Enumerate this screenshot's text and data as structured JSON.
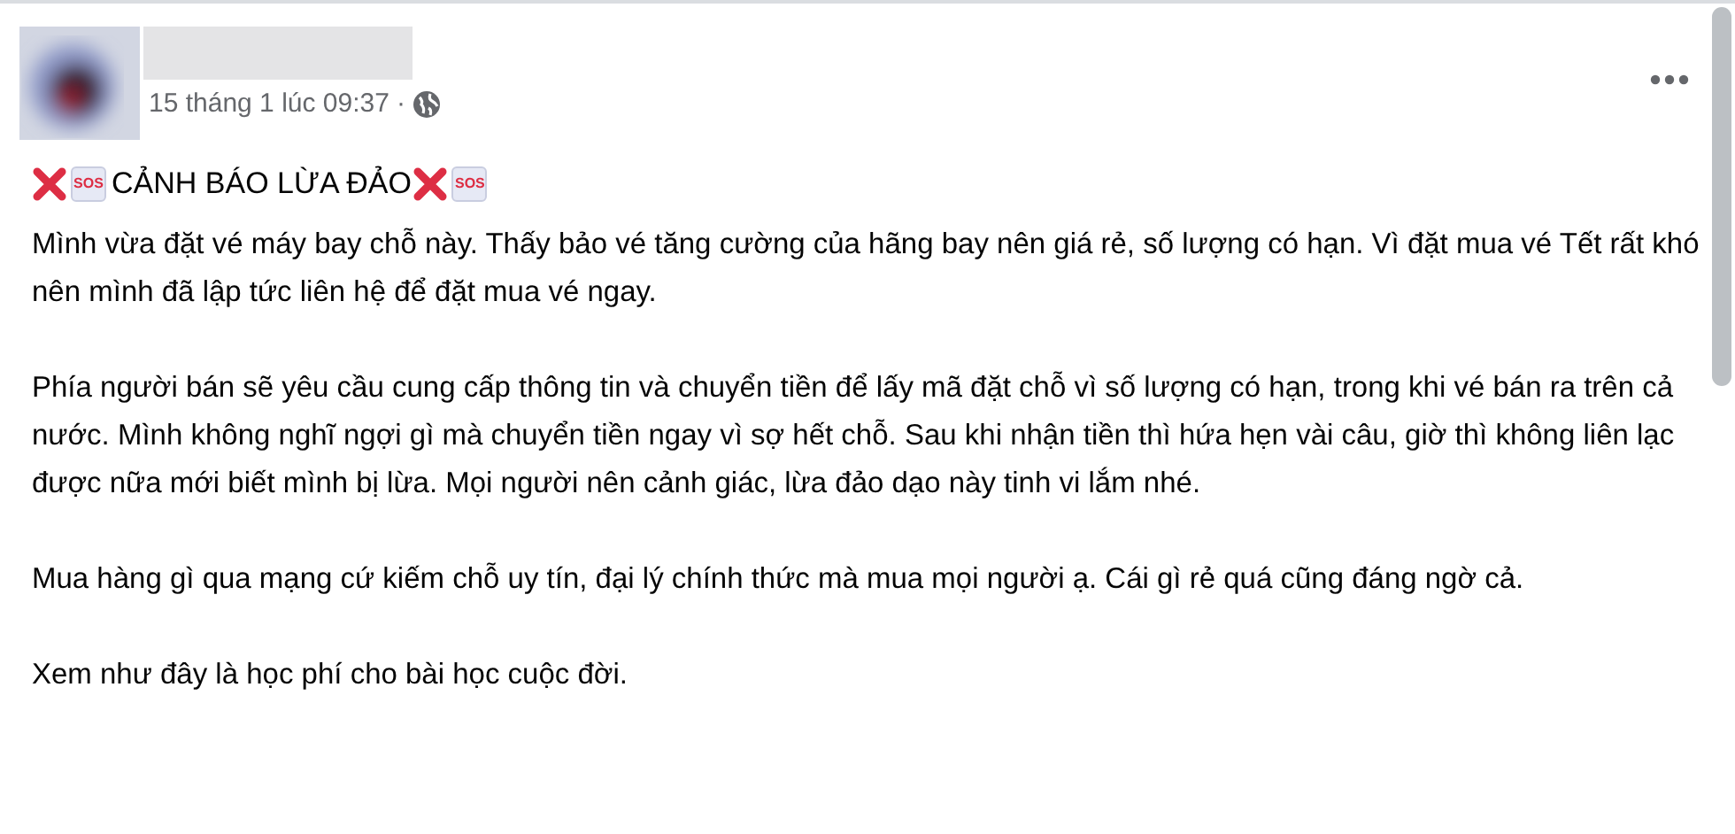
{
  "post": {
    "timestamp": "15 tháng 1 lúc 09:37",
    "separator": "·",
    "heading": {
      "text": "CẢNH BÁO LỪA ĐẢO",
      "before": [
        {
          "kind": "cross"
        },
        {
          "kind": "sos",
          "label": "SOS"
        }
      ],
      "after": [
        {
          "kind": "cross"
        },
        {
          "kind": "sos",
          "label": "SOS"
        }
      ]
    },
    "paragraphs": [
      "Mình vừa đặt vé máy bay chỗ này. Thấy bảo vé tăng cường của hãng bay nên giá rẻ, số lượng có hạn. Vì đặt mua vé Tết rất khó nên mình đã lập tức liên hệ để đặt mua vé ngay.",
      "Phía người bán sẽ yêu cầu cung cấp thông tin và chuyển tiền để lấy mã đặt chỗ vì số lượng có hạn, trong khi vé bán ra trên cả nước. Mình không nghĩ ngợi gì mà chuyển tiền ngay vì sợ hết chỗ. Sau khi nhận tiền thì hứa hẹn vài câu, giờ thì không liên lạc được nữa mới biết mình bị lừa. Mọi người nên cảnh giác, lừa đảo dạo này tinh vi lắm nhé.",
      "Mua hàng gì qua mạng cứ kiếm chỗ uy tín, đại lý chính thức mà mua mọi người ạ. Cái gì rẻ quá cũng đáng ngờ cả.",
      "Xem như đây là học phí cho bài học cuộc đời."
    ]
  }
}
